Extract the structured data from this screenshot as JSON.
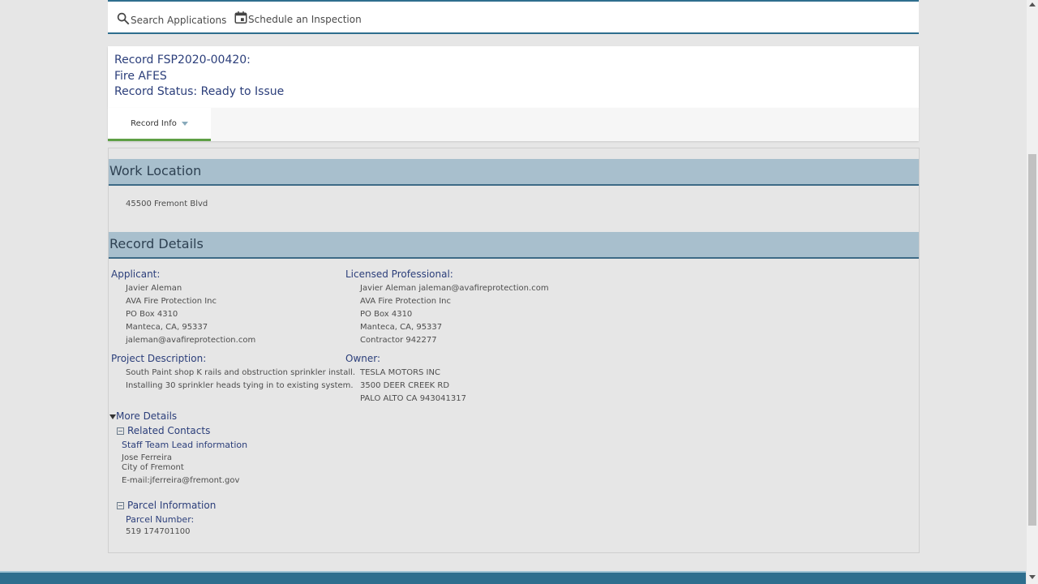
{
  "toolbar": {
    "search_label": "Search Applications",
    "schedule_label": "Schedule an Inspection",
    "search_icon": "search-icon",
    "schedule_icon": "calendar-icon"
  },
  "record": {
    "line1": "Record FSP2020-00420:",
    "line2": "Fire AFES",
    "line3": "Record Status: Ready to Issue"
  },
  "tabs": {
    "record_info": "Record Info"
  },
  "work_location": {
    "title": "Work Location",
    "address": "45500 Fremont Blvd"
  },
  "record_details": {
    "title": "Record Details",
    "applicant_label": "Applicant:",
    "applicant": [
      "Javier Aleman",
      "AVA Fire Protection Inc",
      "PO Box 4310",
      "Manteca, CA, 95337",
      "jaleman@avafireprotection.com"
    ],
    "licensed_label": "Licensed Professional:",
    "licensed": [
      "Javier Aleman jaleman@avafireprotection.com",
      "AVA Fire Protection Inc",
      "PO Box 4310",
      "Manteca, CA, 95337",
      "Contractor 942277"
    ],
    "project_label": "Project Description:",
    "project": [
      "South Paint shop K rails and obstruction sprinkler install.",
      "Installing 30 sprinkler heads tying in to existing system."
    ],
    "owner_label": "Owner:",
    "owner": [
      "TESLA MOTORS INC",
      "3500 DEER CREEK RD",
      "PALO ALTO CA 943041317"
    ]
  },
  "more_details": {
    "label": "More Details",
    "related_contacts": "Related Contacts",
    "staff_heading": "Staff Team Lead information",
    "staff_name": "Jose Ferreira",
    "staff_org": "City of Fremont",
    "staff_email": "E-mail:jferreira@fremont.gov",
    "parcel_info": "Parcel Information",
    "parcel_number_label": "Parcel Number:",
    "parcel_number": "519 174701100"
  },
  "colors": {
    "accent": "#2e6e8e",
    "section_header": "#a8bfcd",
    "label_blue": "#2b3e7a",
    "tab_green": "#5e9f45"
  }
}
